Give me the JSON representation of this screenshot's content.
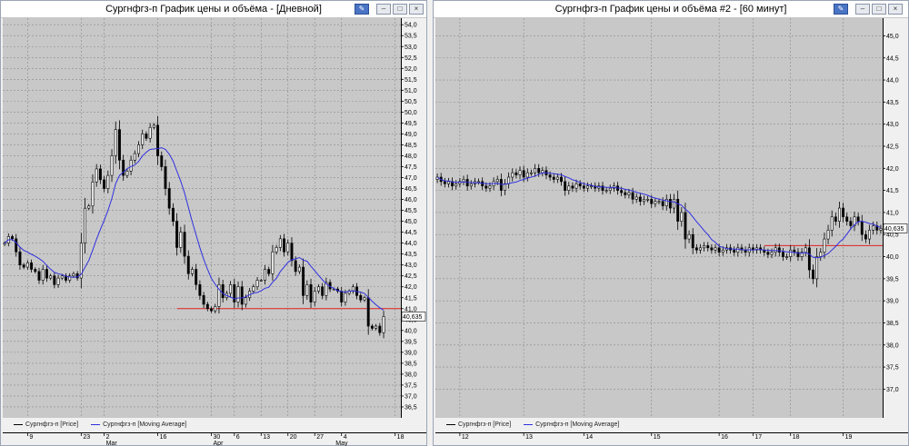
{
  "windows": [
    {
      "title": "Сургнфгз-п График цены и объёма - [Дневной]"
    },
    {
      "title": "Сургнфгз-п График цены и объёма #2 - [60 минут]"
    }
  ],
  "colors": {
    "up_candle": "#ffffff",
    "down_candle": "#000000",
    "ma_line": "#3030e0",
    "level_line": "#e02020",
    "plot_bg": "#c8c8c8",
    "grid": "#8a8a8a"
  },
  "chart_data": [
    {
      "type": "candlestick",
      "title": "Сургнфгз-п График цены и объёма - [Дневной]",
      "ylim": [
        36.0,
        54.3
      ],
      "y_ticks": [
        "54,0",
        "53,5",
        "53,0",
        "52,5",
        "52,0",
        "51,5",
        "51,0",
        "50,5",
        "50,0",
        "49,5",
        "49,0",
        "48,5",
        "48,0",
        "47,5",
        "47,0",
        "46,5",
        "46,0",
        "45,5",
        "45,0",
        "44,5",
        "44,0",
        "43,5",
        "43,0",
        "42,5",
        "42,0",
        "41,5",
        "41,0",
        "40,5",
        "40,0",
        "39,5",
        "39,0",
        "38,5",
        "38,0",
        "37,5",
        "37,0",
        "36,5"
      ],
      "x_ticks": [
        "9",
        "23",
        "2",
        "16",
        "30",
        "6",
        "13",
        "20",
        "27",
        "4",
        "18"
      ],
      "x_tick_pos": [
        6,
        20,
        26,
        40,
        54,
        60,
        67,
        74,
        81,
        88,
        102
      ],
      "month_labels": [
        {
          "label": "Mar",
          "at": 26
        },
        {
          "label": "Apr",
          "at": 54
        },
        {
          "label": "May",
          "at": 86
        }
      ],
      "n": 104,
      "grid": true,
      "last_price_label": "40,635",
      "level_line": {
        "value": 41.0,
        "from": 45,
        "to": 104
      },
      "legend": [
        "Сургнфгз-п [Price]",
        "Сургнфгз-п [Moving Average]"
      ],
      "ma_period": 10,
      "close": [
        44.0,
        44.3,
        44.2,
        43.6,
        43.0,
        42.9,
        43.1,
        42.8,
        42.7,
        42.3,
        42.8,
        42.4,
        42.5,
        42.1,
        42.4,
        42.5,
        42.3,
        42.5,
        42.6,
        42.4,
        44.0,
        45.6,
        45.7,
        46.8,
        47.4,
        46.9,
        46.5,
        47.1,
        48.0,
        49.2,
        47.8,
        47.1,
        47.3,
        47.8,
        48.1,
        48.5,
        49.0,
        48.8,
        49.3,
        49.4,
        48.0,
        47.5,
        46.5,
        45.6,
        45.0,
        43.8,
        44.5,
        43.4,
        42.6,
        42.8,
        42.1,
        41.6,
        41.2,
        41.0,
        40.9,
        41.1,
        42.1,
        41.5,
        41.7,
        42.1,
        41.3,
        42.0,
        41.2,
        41.5,
        41.8,
        42.0,
        42.3,
        42.3,
        42.8,
        42.6,
        43.6,
        43.8,
        44.2,
        43.6,
        44.0,
        43.2,
        42.7,
        42.9,
        41.6,
        42.1,
        41.3,
        41.8,
        42.0,
        41.6,
        42.2,
        41.9,
        41.9,
        41.8,
        41.3,
        41.7,
        41.8,
        42.0,
        41.6,
        41.4,
        41.5,
        40.2,
        40.1,
        40.2,
        39.9,
        40.64
      ]
    },
    {
      "type": "candlestick",
      "title": "Сургнфгз-п График цены и объёма #2 - [60 минут]",
      "ylim": [
        36.35,
        45.4
      ],
      "y_ticks": [
        "45,0",
        "44,5",
        "44,0",
        "43,5",
        "43,0",
        "42,5",
        "42,0",
        "41,5",
        "41,0",
        "40,5",
        "40,0",
        "39,5",
        "39,0",
        "38,5",
        "38,0",
        "37,5",
        "37,0"
      ],
      "x_ticks": [
        "12",
        "13",
        "14",
        "15",
        "16",
        "17",
        "18",
        "19"
      ],
      "x_tick_pos": [
        6,
        23,
        39,
        57,
        75,
        84,
        94,
        108
      ],
      "n": 119,
      "grid": true,
      "last_price_label": "40,635",
      "level_line": {
        "value": 40.25,
        "from": 87,
        "to": 119
      },
      "legend": [
        "Сургнфгз-п [Price]",
        "Сургнфгз-п [Moving Average]"
      ],
      "ma_period": 10,
      "close": [
        41.8,
        41.7,
        41.65,
        41.7,
        41.6,
        41.65,
        41.7,
        41.75,
        41.6,
        41.65,
        41.7,
        41.7,
        41.6,
        41.55,
        41.6,
        41.7,
        41.75,
        41.5,
        41.65,
        41.8,
        41.9,
        41.85,
        41.95,
        41.8,
        41.9,
        41.9,
        42.0,
        41.9,
        41.95,
        41.85,
        41.8,
        41.75,
        41.8,
        41.7,
        41.5,
        41.6,
        41.55,
        41.65,
        41.6,
        41.55,
        41.6,
        41.6,
        41.55,
        41.6,
        41.5,
        41.5,
        41.55,
        41.6,
        41.5,
        41.45,
        41.4,
        41.45,
        41.3,
        41.35,
        41.25,
        41.3,
        41.3,
        41.2,
        41.25,
        41.25,
        41.15,
        41.3,
        41.1,
        41.3,
        40.8,
        41.0,
        40.4,
        40.5,
        40.2,
        40.15,
        40.2,
        40.25,
        40.2,
        40.15,
        40.2,
        40.1,
        40.15,
        40.2,
        40.15,
        40.1,
        40.2,
        40.15,
        40.1,
        40.2,
        40.15,
        40.2,
        40.15,
        40.1,
        40.05,
        40.1,
        40.2,
        40.1,
        40.0,
        40.0,
        40.15,
        40.1,
        40.0,
        40.1,
        40.2,
        39.7,
        39.5,
        40.0,
        40.1,
        40.4,
        40.6,
        40.9,
        40.8,
        41.1,
        40.9,
        40.8,
        40.7,
        40.9,
        40.8,
        40.5,
        40.4,
        40.6,
        40.7,
        40.6,
        40.64
      ]
    }
  ]
}
